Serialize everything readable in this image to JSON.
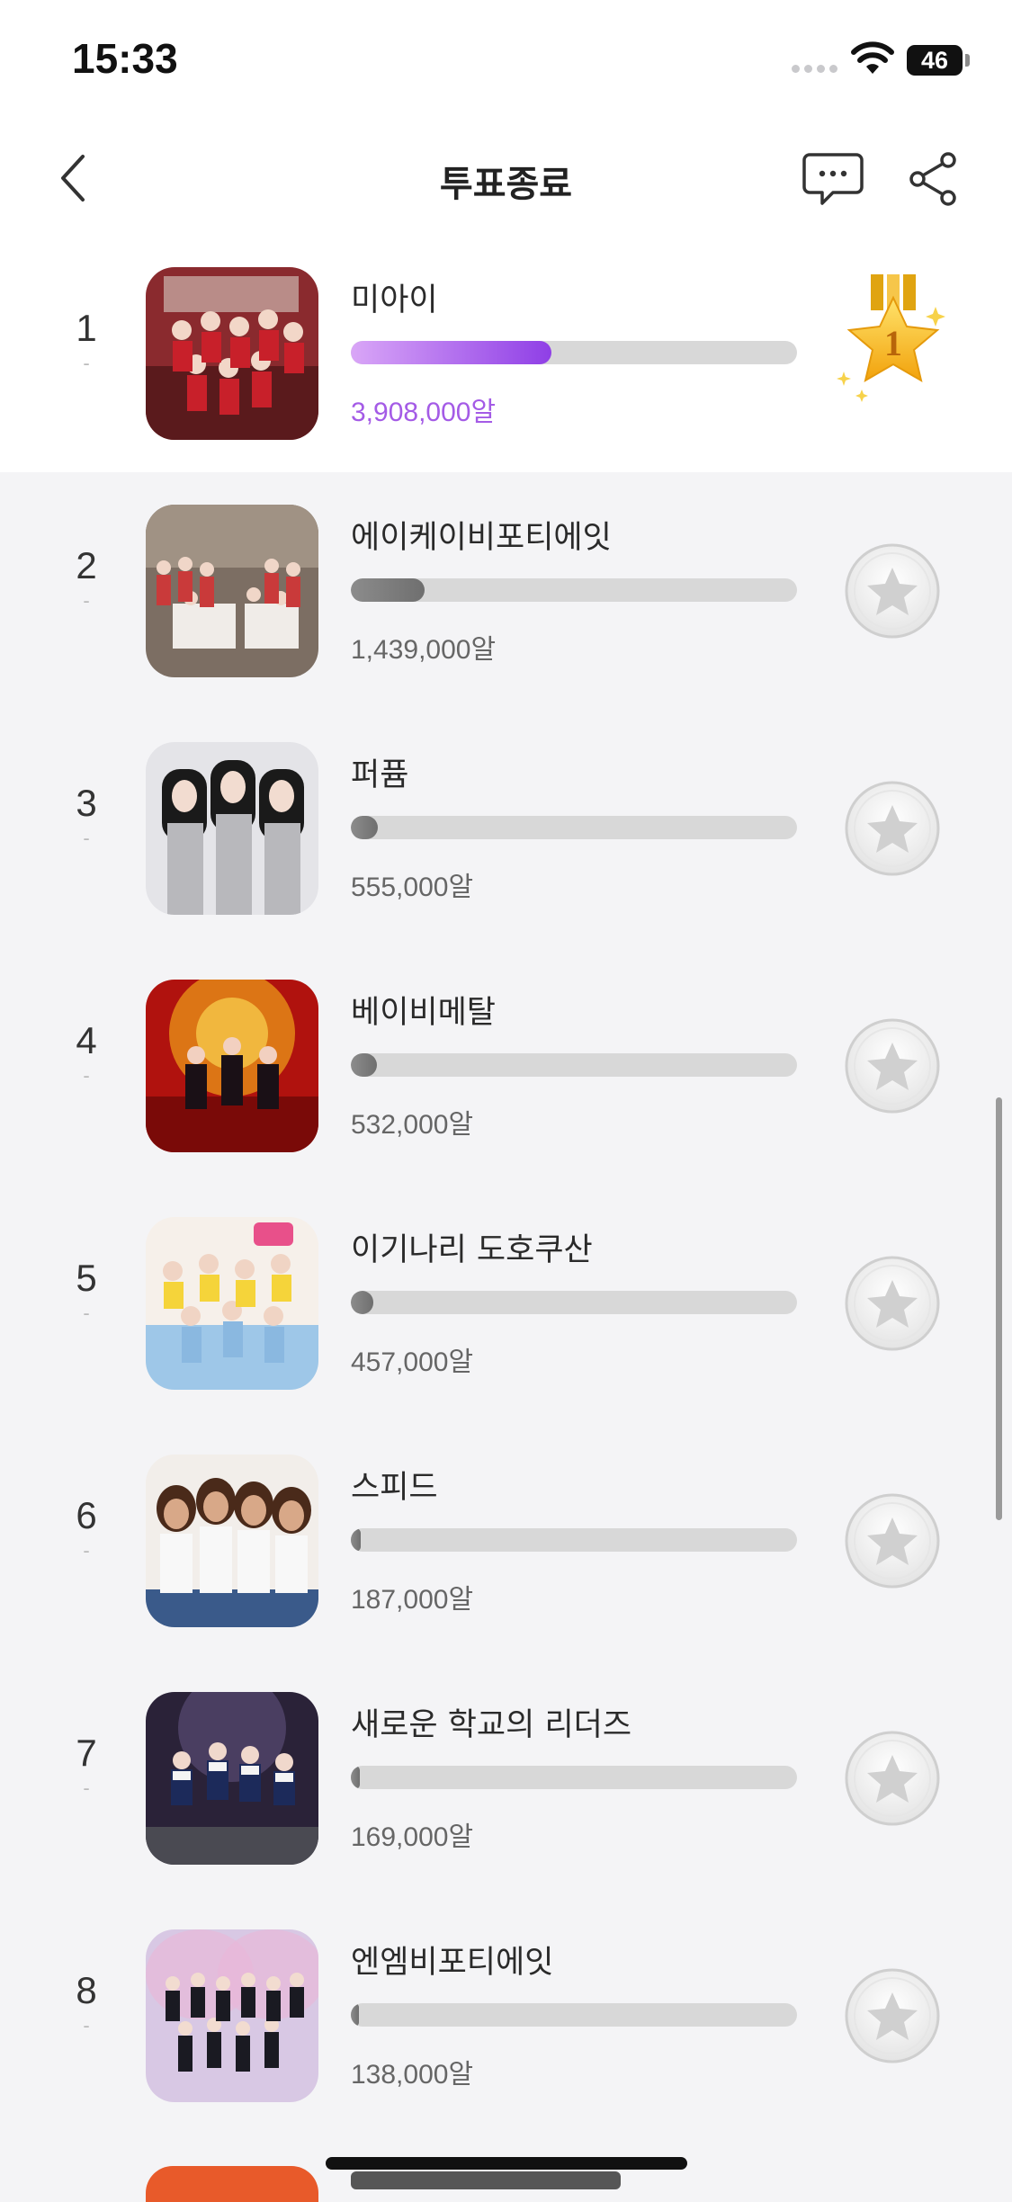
{
  "status_bar": {
    "time": "15:33",
    "battery": "46"
  },
  "header": {
    "title": "투표종료"
  },
  "colors": {
    "accent": "#8f3fe6",
    "accent_light": "#d9a6f7",
    "medal_gold": "#f7b81c",
    "bar_track": "#d8d8d8"
  },
  "list": [
    {
      "rank": "1",
      "change": "-",
      "name": "미아이",
      "votes": "3,908,000알",
      "progress": 0.45,
      "badge": "gold-medal-1",
      "badge_text": "1"
    },
    {
      "rank": "2",
      "change": "-",
      "name": "에이케이비포티에잇",
      "votes": "1,439,000알",
      "progress": 0.165,
      "badge": "star-vote-icon"
    },
    {
      "rank": "3",
      "change": "-",
      "name": "퍼퓸",
      "votes": "555,000알",
      "progress": 0.06,
      "badge": "star-vote-icon"
    },
    {
      "rank": "4",
      "change": "-",
      "name": "베이비메탈",
      "votes": "532,000알",
      "progress": 0.058,
      "badge": "star-vote-icon"
    },
    {
      "rank": "5",
      "change": "-",
      "name": "이기나리 도호쿠산",
      "votes": "457,000알",
      "progress": 0.05,
      "badge": "star-vote-icon"
    },
    {
      "rank": "6",
      "change": "-",
      "name": "스피드",
      "votes": "187,000알",
      "progress": 0.022,
      "badge": "star-vote-icon"
    },
    {
      "rank": "7",
      "change": "-",
      "name": "새로운 학교의 리더즈",
      "votes": "169,000알",
      "progress": 0.02,
      "badge": "star-vote-icon"
    },
    {
      "rank": "8",
      "change": "-",
      "name": "엔엠비포티에잇",
      "votes": "138,000알",
      "progress": 0.017,
      "badge": "star-vote-icon"
    }
  ]
}
